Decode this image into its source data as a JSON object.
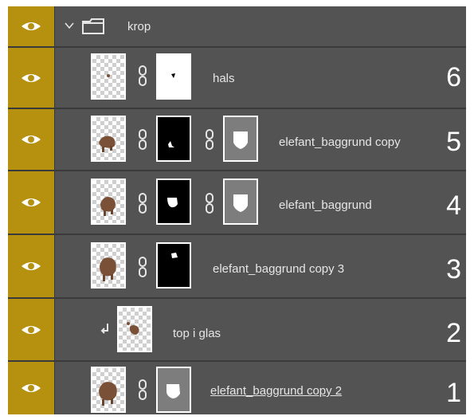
{
  "colors": {
    "visibility_bg": "#b6900f",
    "panel_bg": "#535353",
    "divider": "#3a3a3a",
    "text": "#e6e6e6"
  },
  "group": {
    "name": "krop",
    "expanded": true,
    "icon": "folder-icon"
  },
  "layers": [
    {
      "name": "hals",
      "number": "6",
      "visible": true
    },
    {
      "name": "elefant_baggrund copy",
      "number": "5",
      "visible": true
    },
    {
      "name": "elefant_baggrund",
      "number": "4",
      "visible": true
    },
    {
      "name": "elefant_baggrund copy 3",
      "number": "3",
      "visible": true
    },
    {
      "name": "top i glas",
      "number": "2",
      "visible": true,
      "clipping_mask": true
    },
    {
      "name": "elefant_baggrund copy 2",
      "number": "1",
      "visible": true
    }
  ]
}
